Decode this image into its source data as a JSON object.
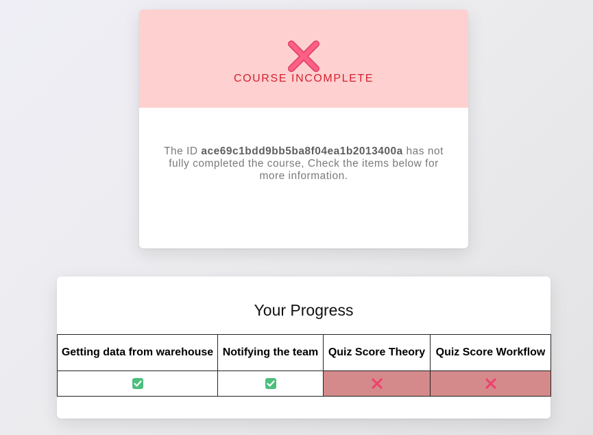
{
  "status": {
    "title": "COURSE INCOMPLETE",
    "icon": "cross-mark-icon",
    "accent_color": "#d3212f",
    "header_color": "#ffd0d0",
    "message_prefix": "The ID ",
    "course_id": "ace69c1bdd9bb5ba8f04ea1b2013400a",
    "message_suffix": " has not fully completed the course, Check the items below for more information."
  },
  "progress": {
    "title": "Your Progress",
    "columns": [
      {
        "header": "Getting data from warehouse",
        "passed": true,
        "icon": "check-mark-icon"
      },
      {
        "header": "Notifying the team",
        "passed": true,
        "icon": "check-mark-icon"
      },
      {
        "header": "Quiz Score Theory",
        "passed": false,
        "icon": "cross-mark-icon"
      },
      {
        "header": "Quiz Score Workflow",
        "passed": false,
        "icon": "cross-mark-icon"
      }
    ],
    "fail_color": "#d48a8a",
    "pass_color": "#3cb371"
  }
}
